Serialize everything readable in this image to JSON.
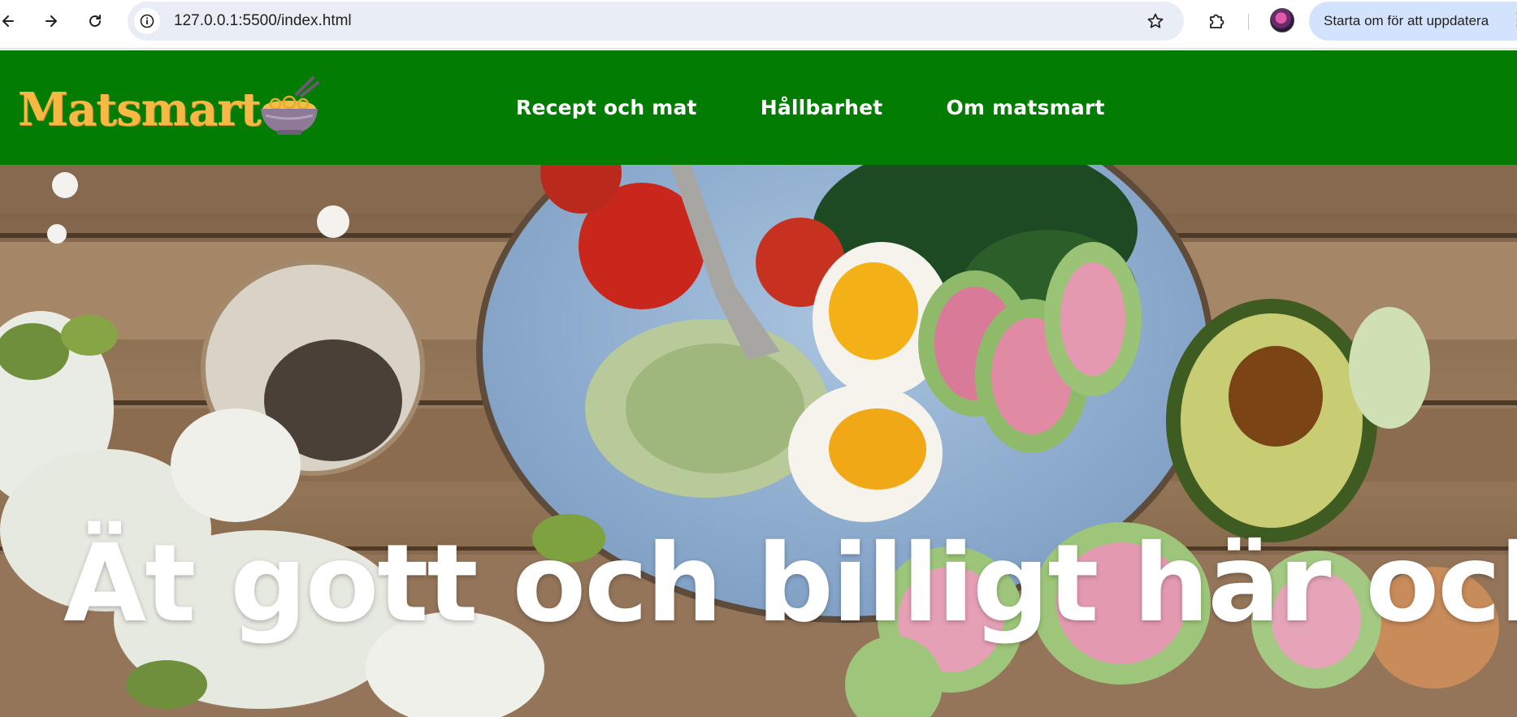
{
  "browser": {
    "url": "127.0.0.1:5500/index.html",
    "update_button_label": "Starta om för att uppdatera",
    "icons": [
      "back-arrow-icon",
      "forward-arrow-icon",
      "reload-icon",
      "site-info-icon",
      "bookmark-star-icon",
      "extensions-puzzle-icon",
      "profile-avatar",
      "more-menu-icon"
    ]
  },
  "header": {
    "logo_text": "Matsmart",
    "logo_icon": "noodle-bowl-icon",
    "nav": [
      {
        "label": "Recept och mat"
      },
      {
        "label": "Hållbarhet"
      },
      {
        "label": "Om matsmart"
      }
    ],
    "colors": {
      "background": "#037c03",
      "logo": "#f7b944",
      "nav_text": "#ffffff"
    }
  },
  "hero": {
    "title": "Ät gott och billigt här och nu!",
    "image": "food-bowl-photo"
  }
}
